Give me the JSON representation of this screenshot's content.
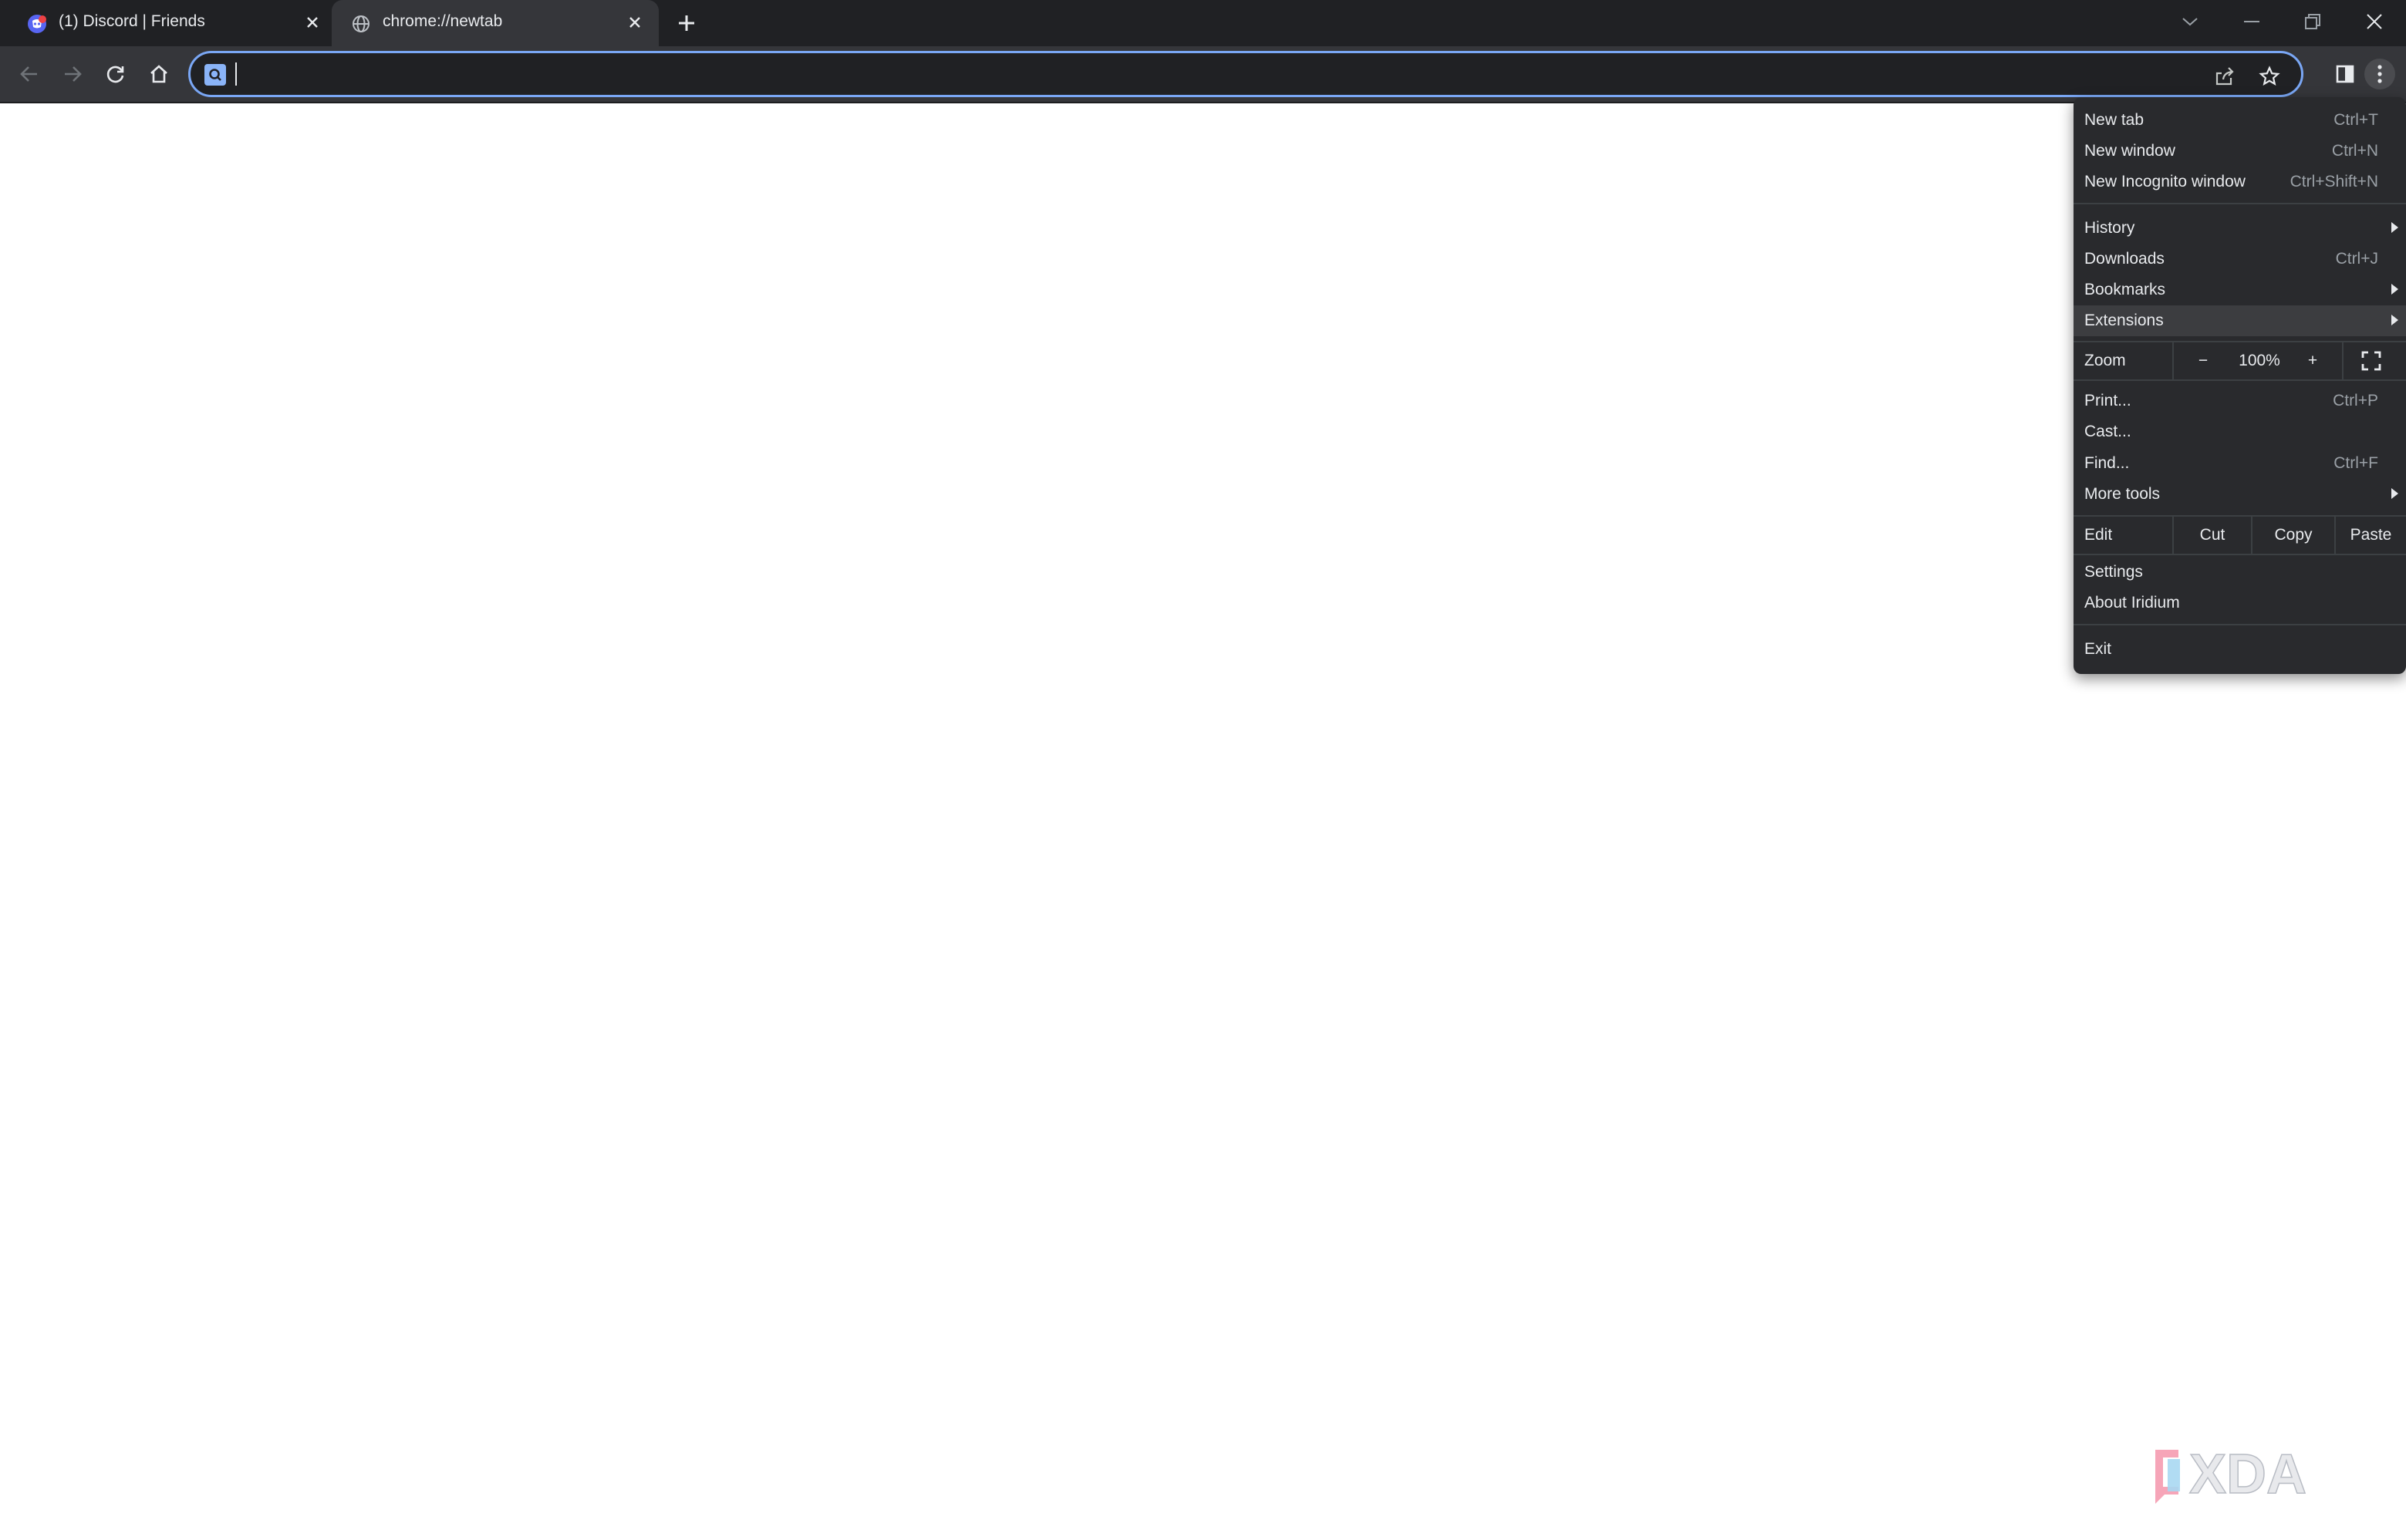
{
  "tabs": [
    {
      "title": "(1) Discord | Friends",
      "favicon": "discord-icon"
    },
    {
      "title": "chrome://newtab",
      "favicon": "globe-icon",
      "active": true
    }
  ],
  "omnibox": {
    "value": "",
    "site_icon": "search-site-icon"
  },
  "menu": {
    "new_tab": {
      "label": "New tab",
      "shortcut": "Ctrl+T"
    },
    "new_window": {
      "label": "New window",
      "shortcut": "Ctrl+N"
    },
    "new_incognito": {
      "label": "New Incognito window",
      "shortcut": "Ctrl+Shift+N"
    },
    "history": {
      "label": "History"
    },
    "downloads": {
      "label": "Downloads",
      "shortcut": "Ctrl+J"
    },
    "bookmarks": {
      "label": "Bookmarks"
    },
    "extensions": {
      "label": "Extensions"
    },
    "zoom": {
      "label": "Zoom",
      "minus": "−",
      "level": "100%",
      "plus": "+"
    },
    "print": {
      "label": "Print...",
      "shortcut": "Ctrl+P"
    },
    "cast": {
      "label": "Cast..."
    },
    "find": {
      "label": "Find...",
      "shortcut": "Ctrl+F"
    },
    "more_tools": {
      "label": "More tools"
    },
    "edit": {
      "label": "Edit",
      "cut": "Cut",
      "copy": "Copy",
      "paste": "Paste"
    },
    "settings": {
      "label": "Settings"
    },
    "about": {
      "label": "About Iridium"
    },
    "exit": {
      "label": "Exit"
    }
  },
  "watermark": {
    "brand": "XDA"
  },
  "colors": {
    "tabstrip_bg": "#202124",
    "toolbar_bg": "#35363a",
    "menu_bg": "#292a2d",
    "omnibox_focus": "#7aa7f5",
    "text": "#e8eaed"
  }
}
